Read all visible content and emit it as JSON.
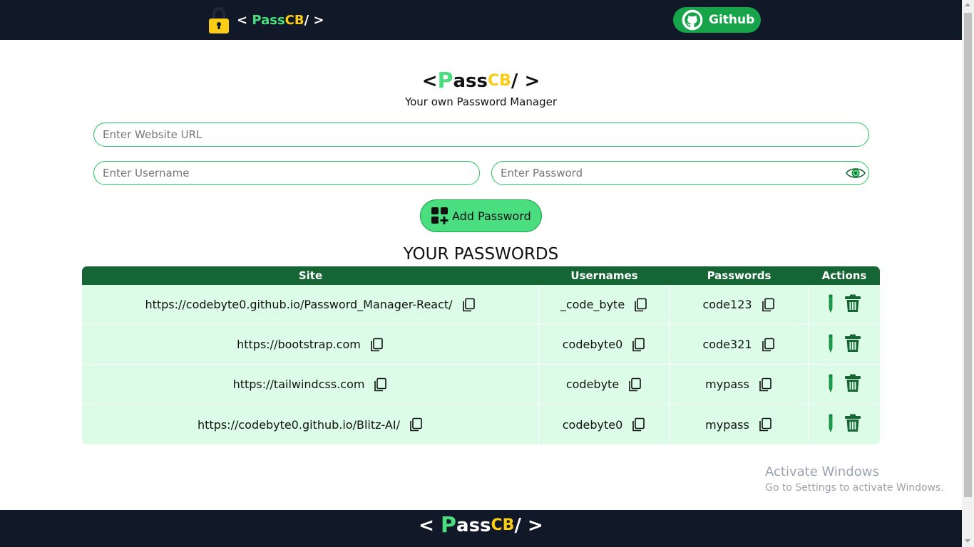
{
  "nav": {
    "brand": {
      "open": "<",
      "p": "Pass",
      "cb": "CB",
      "slash": "/",
      "close": ">"
    },
    "github_label": "Github"
  },
  "header": {
    "brand": {
      "open": "<",
      "p": "P",
      "ass": "ass",
      "cb": "CB",
      "slash": "/",
      "close": ">"
    },
    "subtitle": "Your own Password Manager"
  },
  "form": {
    "url_placeholder": "Enter Website URL",
    "username_placeholder": "Enter Username",
    "password_placeholder": "Enter Password",
    "add_button_label": "Add Password"
  },
  "passwords": {
    "title": "YOUR PASSWORDS",
    "columns": [
      "Site",
      "Usernames",
      "Passwords",
      "Actions"
    ],
    "rows": [
      {
        "site": "https://codebyte0.github.io/Password_Manager-React/",
        "username": "_code_byte",
        "password": "code123"
      },
      {
        "site": "https://bootstrap.com",
        "username": "codebyte0",
        "password": "code321"
      },
      {
        "site": "https://tailwindcss.com",
        "username": "codebyte",
        "password": "mypass"
      },
      {
        "site": "https://codebyte0.github.io/Blitz-AI/",
        "username": "codebyte0",
        "password": "mypass"
      }
    ]
  },
  "watermark": {
    "line1": "Activate Windows",
    "line2": "Go to Settings to activate Windows."
  },
  "footer": {
    "brand": {
      "open": "<",
      "p": "P",
      "ass": "ass",
      "cb": "CB",
      "slash": "/",
      "close": ">"
    }
  },
  "colors": {
    "nav_bg": "#111827",
    "accent_green": "#4ade80",
    "dark_green": "#166534",
    "row_bg": "#dcfce7",
    "brand_yellow": "#facc15"
  },
  "icons": [
    "lock-icon",
    "github-icon",
    "eye-icon",
    "add-grid-icon",
    "copy-icon",
    "edit-icon",
    "trash-icon"
  ]
}
